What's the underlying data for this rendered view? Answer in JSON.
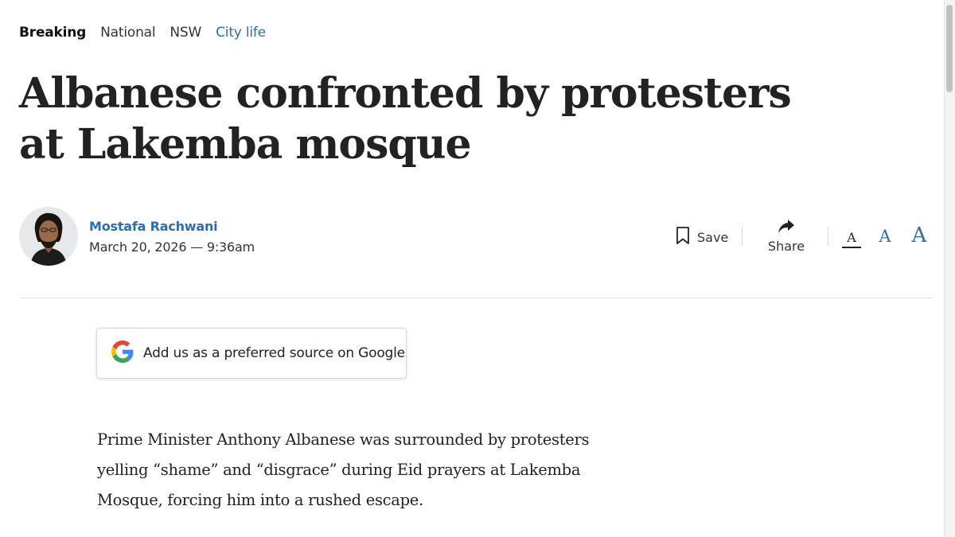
{
  "breadcrumb": {
    "items": [
      {
        "label": "Breaking"
      },
      {
        "label": "National"
      },
      {
        "label": "NSW"
      },
      {
        "label": "City life"
      }
    ]
  },
  "article": {
    "headline": "Albanese confronted by protesters at Lakemba mosque",
    "author": "Mostafa Rachwani",
    "date": "March 20, 2026 — 9:36am",
    "body": "Prime Minister Anthony Albanese was surrounded by protesters yelling “shame” and “disgrace” during Eid prayers at Lakemba Mosque, forcing him into a rushed escape."
  },
  "tools": {
    "save_label": "Save",
    "share_label": "Share",
    "font_sizes": [
      "A",
      "A",
      "A"
    ]
  },
  "google_card": {
    "label": "Add us as a preferred source on Google"
  },
  "colors": {
    "accent": "#2d6db5",
    "text": "#222222",
    "rule": "#dedede"
  }
}
